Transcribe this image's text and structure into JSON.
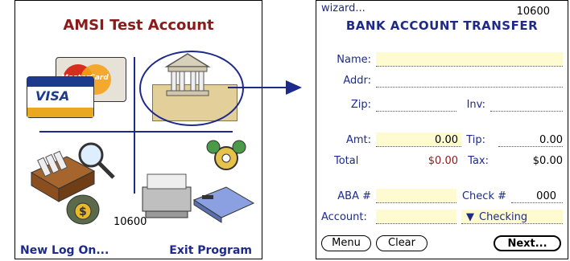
{
  "left_screen": {
    "title": "AMSI Test Account",
    "log_id": "10600",
    "new_log_on_label": "New Log On...",
    "exit_program_label": "Exit Program",
    "card_labels": {
      "mastercard": "MasterCard",
      "visa": "VISA"
    },
    "quadrants": [
      "credit-card-icon",
      "bank-check-icon",
      "search-files-icon",
      "printer-gears-icon"
    ]
  },
  "right_screen": {
    "wizard_label": "wizard...",
    "account_id": "10600",
    "form_title": "BANK ACCOUNT TRANSFER",
    "labels": {
      "name": "Name:",
      "addr": "Addr:",
      "zip": "Zip:",
      "inv": "Inv:",
      "amt": "Amt:",
      "tip": "Tip:",
      "total": "Total",
      "tax": "Tax:",
      "aba": "ABA #",
      "check": "Check #",
      "account": "Account:"
    },
    "values": {
      "amt": "0.00",
      "tip": "0.00",
      "total": "$0.00",
      "tax": "$0.00",
      "check_no": "000",
      "account_type": "Checking"
    },
    "buttons": {
      "menu": "Menu",
      "clear": "Clear",
      "next": "Next..."
    }
  },
  "colors": {
    "brand_blue": "#1d2a8c",
    "title_red": "#8b1a1a",
    "field_yellow": "#fffbd0"
  }
}
